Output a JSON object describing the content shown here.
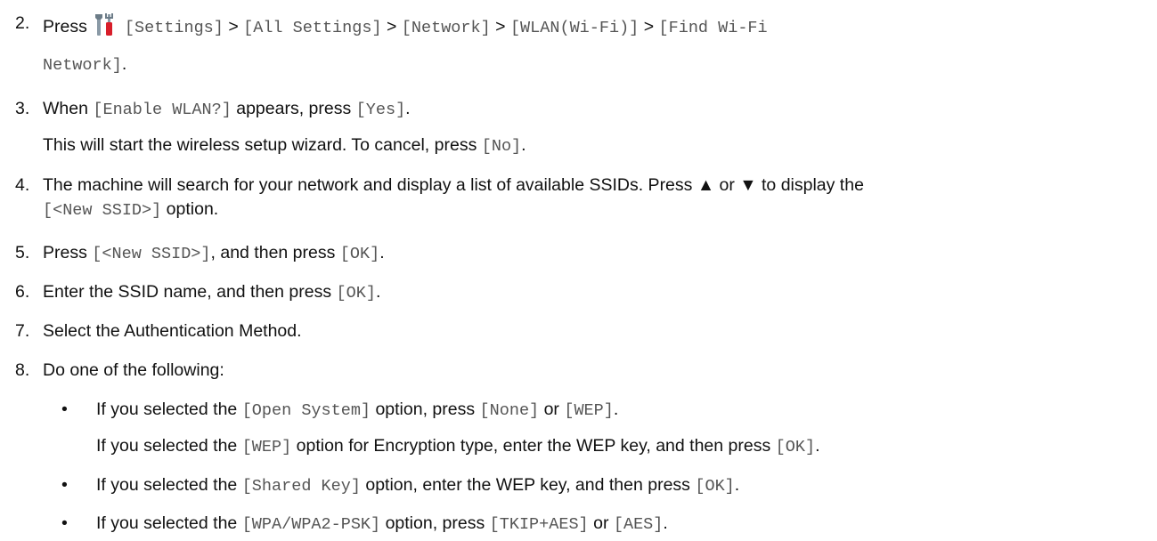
{
  "steps": [
    {
      "number": "2.",
      "press": "Press",
      "icon": "settings-tools-icon",
      "settings": "[Settings]",
      "sep1": ">",
      "all_settings": "[All Settings]",
      "sep2": ">",
      "network": "[Network]",
      "sep3": ">",
      "wlan": "[WLAN(Wi-Fi)]",
      "sep4": ">",
      "find_wifi_1": "[Find Wi-Fi",
      "find_wifi_2": "Network]",
      "end": "."
    },
    {
      "number": "3.",
      "when": "When",
      "enable_wlan": "[Enable WLAN?]",
      "appears_press": "appears, press",
      "yes": "[Yes]",
      "end": ".",
      "sub_text": "This will start the wireless setup wizard. To cancel, press",
      "no": "[No]",
      "sub_end": "."
    },
    {
      "number": "4.",
      "text": "The machine will search for your network and display a list of available SSIDs. Press ▲ or ▼ to display the",
      "new_ssid": "[<New SSID>]",
      "option": "option."
    },
    {
      "number": "5.",
      "press": "Press",
      "new_ssid": "[<New SSID>]",
      "then": ", and then press",
      "ok": "[OK]",
      "end": "."
    },
    {
      "number": "6.",
      "text": "Enter the SSID name, and then press",
      "ok": "[OK]",
      "end": "."
    },
    {
      "number": "7.",
      "text": "Select the Authentication Method."
    },
    {
      "number": "8.",
      "text": "Do one of the following:"
    }
  ],
  "bullets": [
    {
      "dot": "•",
      "a": "If you selected the",
      "open_system": "[Open System]",
      "b": "option, press",
      "none": "[None]",
      "or": "or",
      "wep": "[WEP]",
      "end": ".",
      "sub_a": "If you selected the",
      "sub_wep": "[WEP]",
      "sub_b": "option for Encryption type, enter the WEP key, and then press",
      "sub_ok": "[OK]",
      "sub_end": "."
    },
    {
      "dot": "•",
      "a": "If you selected the",
      "shared_key": "[Shared Key]",
      "b": "option, enter the WEP key, and then press",
      "ok": "[OK]",
      "end": "."
    },
    {
      "dot": "•",
      "a": "If you selected the",
      "wpa": "[WPA/WPA2-PSK]",
      "b": "option, press",
      "tkip": "[TKIP+AES]",
      "or": "or",
      "aes": "[AES]",
      "end": "."
    }
  ]
}
